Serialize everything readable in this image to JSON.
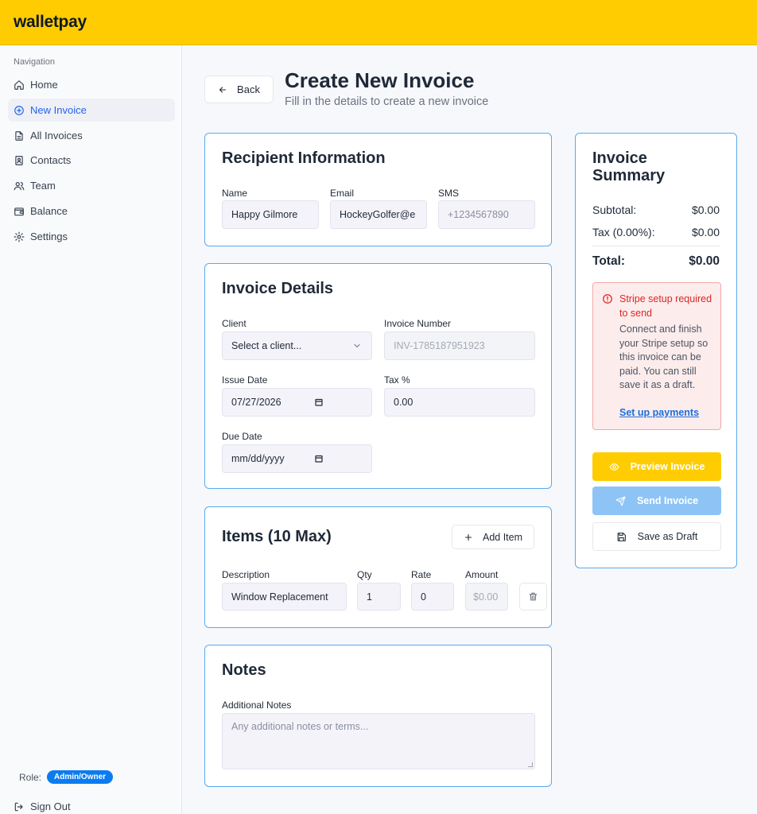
{
  "app": {
    "brand": "walletpay"
  },
  "sidebar": {
    "heading": "Navigation",
    "items": [
      {
        "label": "Home",
        "icon": "home-icon"
      },
      {
        "label": "New Invoice",
        "icon": "plus-circle-icon",
        "active": true
      },
      {
        "label": "All Invoices",
        "icon": "file-text-icon"
      },
      {
        "label": "Contacts",
        "icon": "contact-book-icon"
      },
      {
        "label": "Team",
        "icon": "users-icon"
      },
      {
        "label": "Balance",
        "icon": "wallet-icon"
      },
      {
        "label": "Settings",
        "icon": "gear-icon"
      }
    ],
    "role_label": "Role:",
    "role_value": "Admin/Owner",
    "sign_out": "Sign Out"
  },
  "header": {
    "back_label": "Back",
    "title": "Create New Invoice",
    "subtitle": "Fill in the details to create a new invoice"
  },
  "recipient": {
    "title": "Recipient Information",
    "name_label": "Name",
    "name_value": "Happy Gilmore",
    "email_label": "Email",
    "email_value": "HockeyGolfer@e",
    "sms_label": "SMS",
    "sms_placeholder": "+1234567890"
  },
  "details": {
    "title": "Invoice Details",
    "client_label": "Client",
    "client_value": "Select a client...",
    "invoice_number_label": "Invoice Number",
    "invoice_number_value": "INV-1785187951923",
    "issue_date_label": "Issue Date",
    "issue_date_value": "07/27/2026",
    "tax_label": "Tax %",
    "tax_value": "0.00",
    "due_date_label": "Due Date",
    "due_date_placeholder": "mm/dd/yyyy"
  },
  "items": {
    "title": "Items (10 Max)",
    "add_label": "Add Item",
    "col_description": "Description",
    "col_qty": "Qty",
    "col_rate": "Rate",
    "col_amount": "Amount",
    "rows": [
      {
        "description": "Window Replacement",
        "qty": "1",
        "rate": "0",
        "amount": "$0.00"
      }
    ]
  },
  "notes": {
    "title": "Notes",
    "label": "Additional Notes",
    "placeholder": "Any additional notes or terms..."
  },
  "summary": {
    "title": "Invoice Summary",
    "subtotal_label": "Subtotal:",
    "subtotal_value": "$0.00",
    "tax_label": "Tax (0.00%):",
    "tax_value": "$0.00",
    "total_label": "Total:",
    "total_value": "$0.00",
    "alert_title": "Stripe setup required to send",
    "alert_body": "Connect and finish your Stripe setup so this invoice can be paid. You can still save it as a draft.",
    "alert_link": "Set up payments",
    "preview_label": "Preview Invoice",
    "send_label": "Send Invoice",
    "draft_label": "Save as Draft"
  },
  "colors": {
    "brand_yellow": "#fecc00",
    "accent_blue": "#2563eb",
    "card_border": "#5aa9ee",
    "alert_red": "#dc2626",
    "send_disabled": "#8ec4f5"
  }
}
